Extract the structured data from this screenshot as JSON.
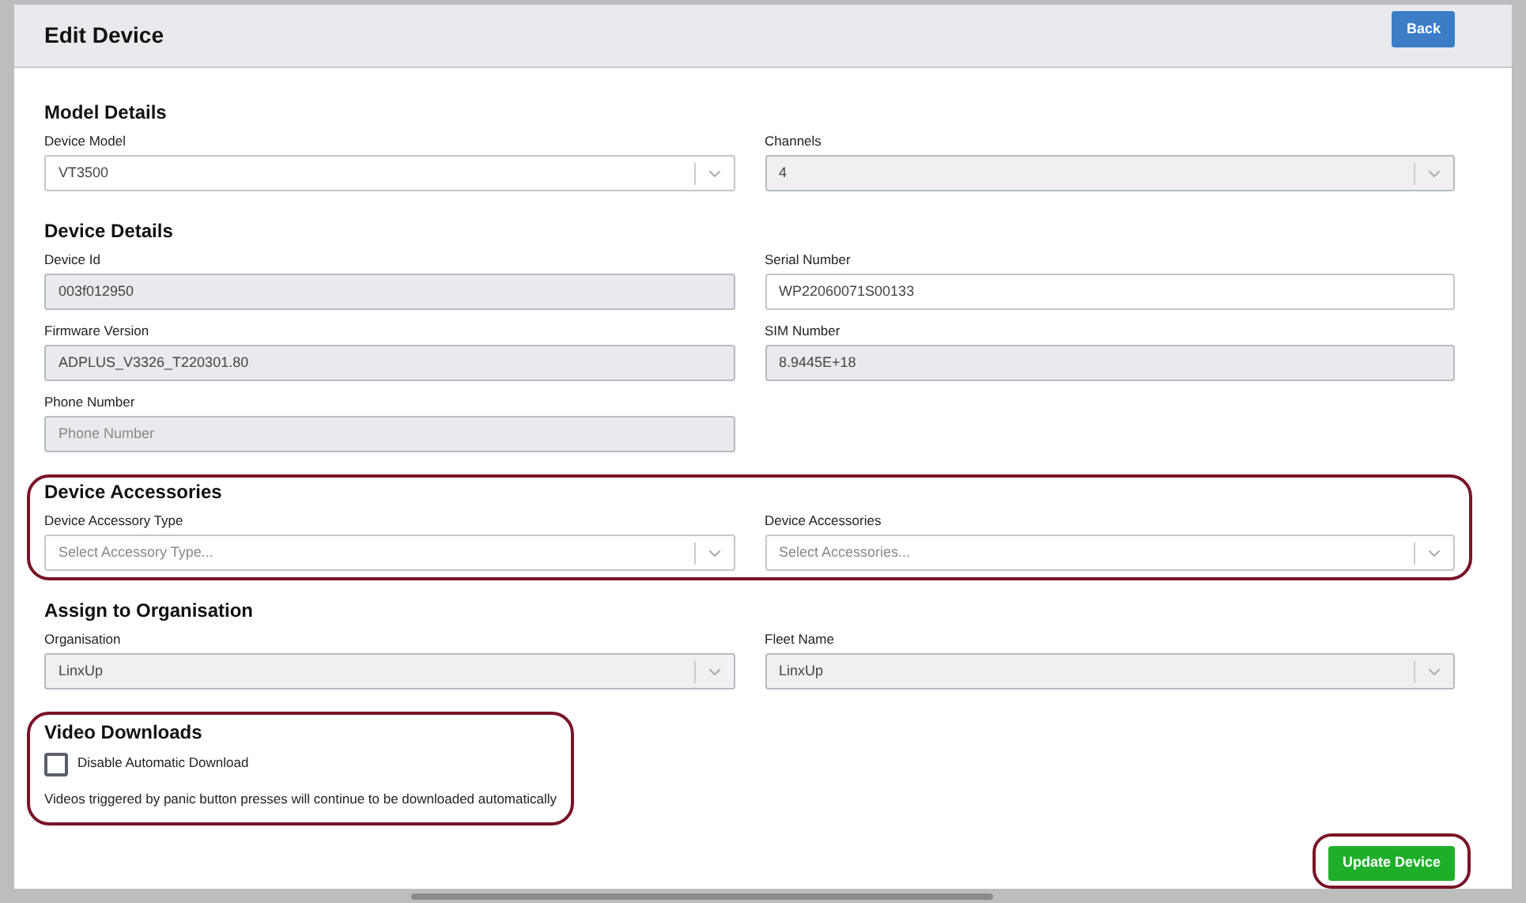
{
  "header": {
    "title": "Edit Device",
    "back_button": "Back"
  },
  "sections": [
    {
      "title": "Model Details",
      "highlighted": false,
      "fields": [
        {
          "label": "Device Model",
          "kind": "select",
          "value": "VT3500",
          "disabled": false
        },
        {
          "label": "Channels",
          "kind": "select",
          "value": "4",
          "disabled": true
        }
      ]
    },
    {
      "title": "Device Details",
      "highlighted": false,
      "fields": [
        {
          "label": "Device Id",
          "kind": "text",
          "value": "003f012950",
          "disabled": true
        },
        {
          "label": "Serial Number",
          "kind": "text",
          "value": "WP22060071S00133",
          "disabled": false
        },
        {
          "label": "Firmware Version",
          "kind": "text",
          "value": "ADPLUS_V3326_T220301.80",
          "disabled": true
        },
        {
          "label": "SIM Number",
          "kind": "text",
          "value": "8.9445E+18",
          "disabled": true
        },
        {
          "label": "Phone Number",
          "kind": "text",
          "placeholder": "Phone Number",
          "disabled": true
        }
      ]
    },
    {
      "title": "Device Accessories",
      "highlighted": true,
      "fields": [
        {
          "label": "Device Accessory Type",
          "kind": "select",
          "placeholder": "Select Accessory Type...",
          "disabled": false
        },
        {
          "label": "Device Accessories",
          "kind": "select",
          "placeholder": "Select Accessories...",
          "disabled": false
        }
      ]
    },
    {
      "title": "Assign to Organisation",
      "highlighted": false,
      "fields": [
        {
          "label": "Organisation",
          "kind": "select",
          "value": "LinxUp",
          "disabled": true
        },
        {
          "label": "Fleet Name",
          "kind": "select",
          "value": "LinxUp",
          "disabled": true
        }
      ]
    }
  ],
  "video_downloads": {
    "title": "Video Downloads",
    "highlighted": true,
    "checkbox": {
      "label": "Disable Automatic Download",
      "checked": false
    },
    "note": "Videos triggered by panic button presses will continue to be downloaded automatically"
  },
  "submit_button": {
    "label": "Update Device",
    "highlighted": true
  }
}
